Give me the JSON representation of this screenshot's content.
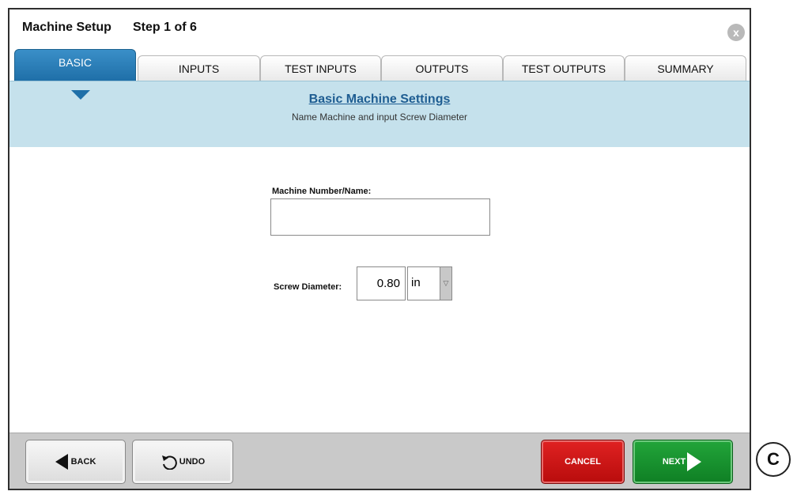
{
  "window": {
    "title": "Machine Setup",
    "step": "Step 1 of 6",
    "close_label": "x"
  },
  "tabs": [
    {
      "label": "BASIC",
      "active": true
    },
    {
      "label": "INPUTS",
      "active": false
    },
    {
      "label": "TEST INPUTS",
      "active": false
    },
    {
      "label": "OUTPUTS",
      "active": false
    },
    {
      "label": "TEST OUTPUTS",
      "active": false
    },
    {
      "label": "SUMMARY",
      "active": false
    }
  ],
  "banner": {
    "title": "Basic Machine Settings",
    "subtitle": "Name Machine and input Screw Diameter"
  },
  "form": {
    "name_label": "Machine Number/Name:",
    "name_value": "",
    "screw_label": "Screw Diameter:",
    "screw_value": "0.80",
    "unit_value": "in"
  },
  "footer": {
    "back_label": "BACK",
    "undo_label": "UNDO",
    "cancel_label": "CANCEL",
    "next_label": "NEXT"
  },
  "side_label": "C",
  "colors": {
    "active_tab": "#1f6fa8",
    "banner_bg": "#c5e1ec",
    "cancel": "#c81414",
    "next": "#16922e",
    "link_title": "#1e5d92"
  }
}
